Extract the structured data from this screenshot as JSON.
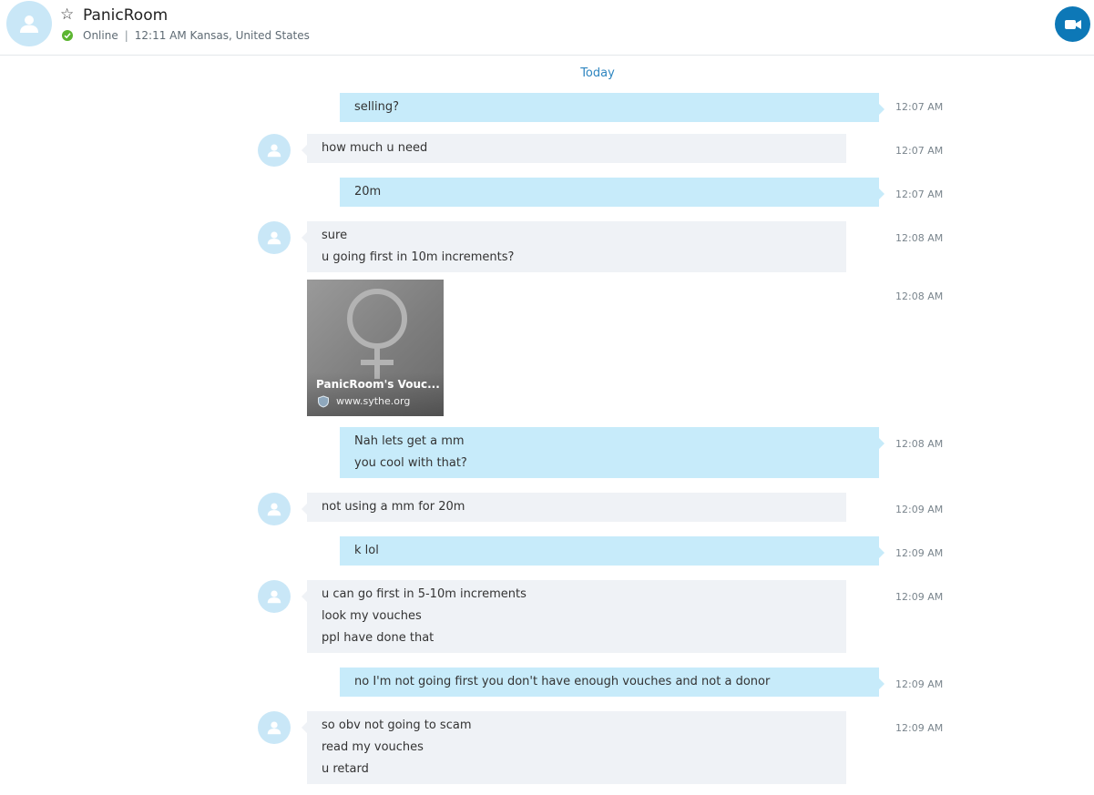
{
  "header": {
    "name": "PanicRoom",
    "status": "Online",
    "local_time": "12:11 AM Kansas, United States",
    "separator": "|"
  },
  "day_label": "Today",
  "messages": [
    {
      "dir": "out",
      "lines": [
        "selling?"
      ],
      "time": "12:07 AM"
    },
    {
      "dir": "in",
      "lines": [
        "how much u need"
      ],
      "time": "12:07 AM"
    },
    {
      "dir": "out",
      "lines": [
        "20m"
      ],
      "time": "12:07 AM"
    },
    {
      "dir": "in",
      "lines": [
        "sure",
        "u going first in 10m increments?"
      ],
      "time": "12:08 AM"
    },
    {
      "dir": "in",
      "type": "link",
      "title": "PanicRoom's Vouc...",
      "site": "www.sythe.org",
      "time": "12:08 AM"
    },
    {
      "dir": "out",
      "lines": [
        "Nah lets get a mm",
        "you cool with that?"
      ],
      "time": "12:08 AM"
    },
    {
      "dir": "in",
      "lines": [
        "not using a mm for 20m"
      ],
      "time": "12:09 AM"
    },
    {
      "dir": "out",
      "lines": [
        "k lol"
      ],
      "time": "12:09 AM"
    },
    {
      "dir": "in",
      "lines": [
        "u can go first in 5-10m increments",
        "look my vouches",
        "ppl have done that"
      ],
      "time": "12:09 AM"
    },
    {
      "dir": "out",
      "lines": [
        "no I'm not going first you don't have enough vouches and not a donor"
      ],
      "time": "12:09 AM"
    },
    {
      "dir": "in",
      "lines": [
        "so obv not going to scam",
        "read my vouches",
        "u retard"
      ],
      "time": "12:09 AM"
    }
  ],
  "colors": {
    "outgoing_bubble": "#c7ebfa",
    "incoming_bubble": "#eff2f6",
    "accent": "#0d78b7",
    "online": "#5cb531"
  },
  "icons": {
    "contact_avatar": "person-icon",
    "favorite": "star-outline-icon",
    "status": "checkmark-icon",
    "video_call": "video-camera-icon",
    "link_security": "shield-icon"
  }
}
